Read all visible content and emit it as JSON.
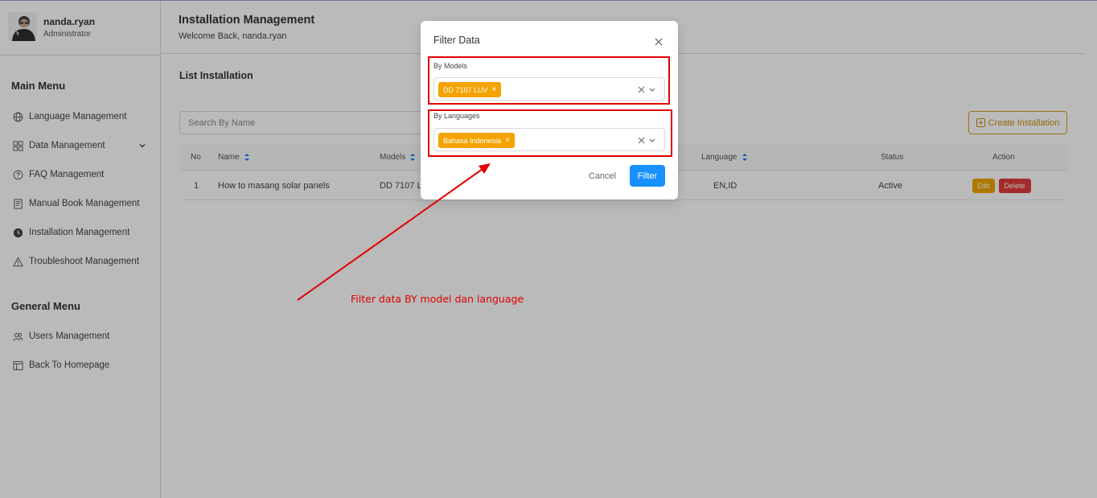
{
  "profile": {
    "name": "nanda.ryan",
    "role": "Administrator"
  },
  "sidebar": {
    "main_menu_title": "Main Menu",
    "main_items": [
      {
        "label": "Language Management",
        "icon": "globe-icon"
      },
      {
        "label": "Data Management",
        "icon": "grid-icon",
        "has_submenu": true
      },
      {
        "label": "FAQ Management",
        "icon": "question-circle-icon"
      },
      {
        "label": "Manual Book Management",
        "icon": "document-icon"
      },
      {
        "label": "Installation Management",
        "icon": "clock-icon",
        "active": true
      },
      {
        "label": "Troubleshoot Management",
        "icon": "warning-icon"
      }
    ],
    "general_menu_title": "General Menu",
    "general_items": [
      {
        "label": "Users Management",
        "icon": "users-icon"
      },
      {
        "label": "Back To Homepage",
        "icon": "layout-icon"
      }
    ]
  },
  "header": {
    "title": "Installation Management",
    "subtitle": "Welcome Back, nanda.ryan"
  },
  "list": {
    "title": "List Installation",
    "search_placeholder": "Search By Name",
    "create_label": "Create Installation",
    "columns": {
      "no": "No",
      "name": "Name",
      "models": "Models",
      "language": "Language",
      "status": "Status",
      "action": "Action"
    },
    "rows": [
      {
        "no": "1",
        "name": "How to masang solar panels",
        "models": "DD 7107 L",
        "language": "EN,ID",
        "status": "Active",
        "edit_label": "Edit",
        "delete_label": "Delete"
      }
    ]
  },
  "modal": {
    "title": "Filter Data",
    "models_label": "By Models",
    "models_tag": "DD 7107 LUV",
    "languages_label": "By Languages",
    "languages_tag": "Bahasa Indonesia",
    "cancel_label": "Cancel",
    "filter_label": "Filter"
  },
  "annotation": {
    "text": "Filter data BY model dan language",
    "color": "#e00000"
  },
  "colors": {
    "accent": "#1890ff",
    "tag": "#f5a300",
    "create": "#c8900d",
    "delete": "#e03b3b"
  }
}
